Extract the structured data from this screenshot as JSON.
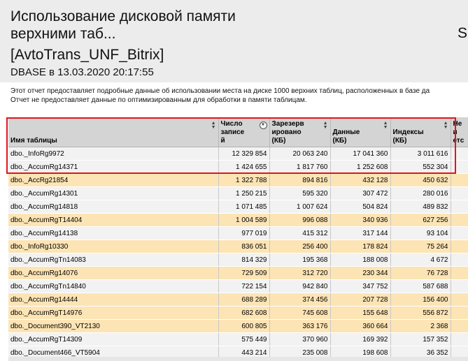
{
  "report": {
    "title_line1": "Использование дисковой памяти",
    "title_line2": "верхними таб...",
    "title_line3": "[AvtoTrans_UNF_Bitrix]",
    "subtitle": "DBASE в 13.03.2020 20:17:55",
    "right_edge_text": "S(",
    "description_line1": "Этот отчет предоставляет подробные данные об использовании места на диске 1000 верхних таблиц, расположенных в базе да",
    "description_line2": "Отчет не предоставляет данные по оптимизированным для обработки в памяти таблицам."
  },
  "table": {
    "headers": {
      "name": "Имя таблицы",
      "records": "Число записей",
      "reserved": "Зарезервировано (КБ)",
      "data": "Данные (КБ)",
      "indexes": "Индексы (КБ)",
      "unused": "Не испол..."
    },
    "header_display": {
      "records": [
        "Число",
        "записе",
        "й"
      ],
      "reserved": [
        "Зарезерв",
        "ировано",
        "(КБ)"
      ],
      "data": [
        "Данные",
        "(КБ)"
      ],
      "indexes": [
        "Индексы",
        "(КБ)"
      ],
      "unused": [
        "Не",
        "и",
        "етс"
      ]
    },
    "rows": [
      {
        "name": "dbo._InfoRg9972",
        "records": "12 329 854",
        "reserved": "20 063 240",
        "data": "17 041 360",
        "indexes": "3 011 616",
        "shade": "w"
      },
      {
        "name": "dbo._AccumRg14371",
        "records": "1 424 655",
        "reserved": "1 817 760",
        "data": "1 252 608",
        "indexes": "552 304",
        "shade": "w"
      },
      {
        "name": "dbo._AccRg21854",
        "records": "1 322 788",
        "reserved": "894 816",
        "data": "432 128",
        "indexes": "450 632",
        "shade": "o"
      },
      {
        "name": "dbo._AccumRg14301",
        "records": "1 250 215",
        "reserved": "595 320",
        "data": "307 472",
        "indexes": "280 016",
        "shade": "w"
      },
      {
        "name": "dbo._AccumRg14818",
        "records": "1 071 485",
        "reserved": "1 007 624",
        "data": "504 824",
        "indexes": "489 832",
        "shade": "w"
      },
      {
        "name": "dbo._AccumRgT14404",
        "records": "1 004 589",
        "reserved": "996 088",
        "data": "340 936",
        "indexes": "627 256",
        "shade": "o"
      },
      {
        "name": "dbo._AccumRg14138",
        "records": "977 019",
        "reserved": "415 312",
        "data": "317 144",
        "indexes": "93 104",
        "shade": "w"
      },
      {
        "name": "dbo._InfoRg10330",
        "records": "836 051",
        "reserved": "256 400",
        "data": "178 824",
        "indexes": "75 264",
        "shade": "o"
      },
      {
        "name": "dbo._AccumRgTn14083",
        "records": "814 329",
        "reserved": "195 368",
        "data": "188 008",
        "indexes": "4 672",
        "shade": "w"
      },
      {
        "name": "dbo._AccumRg14076",
        "records": "729 509",
        "reserved": "312 720",
        "data": "230 344",
        "indexes": "76 728",
        "shade": "o"
      },
      {
        "name": "dbo._AccumRgTn14840",
        "records": "722 154",
        "reserved": "942 840",
        "data": "347 752",
        "indexes": "587 688",
        "shade": "w"
      },
      {
        "name": "dbo._AccumRg14444",
        "records": "688 289",
        "reserved": "374 456",
        "data": "207 728",
        "indexes": "156 400",
        "shade": "o"
      },
      {
        "name": "dbo._AccumRgT14976",
        "records": "682 608",
        "reserved": "745 608",
        "data": "155 648",
        "indexes": "556 872",
        "shade": "o"
      },
      {
        "name": "dbo._Document390_VT2130",
        "records": "600 805",
        "reserved": "363 176",
        "data": "360 664",
        "indexes": "2 368",
        "shade": "o"
      },
      {
        "name": "dbo._AccumRgT14309",
        "records": "575 449",
        "reserved": "370 960",
        "data": "169 392",
        "indexes": "157 352",
        "shade": "w"
      },
      {
        "name": "dbo._Document466_VT5904",
        "records": "443 214",
        "reserved": "235 008",
        "data": "198 608",
        "indexes": "36 352",
        "shade": "w"
      }
    ]
  },
  "colors": {
    "header_bg": "#ececec",
    "row_white": "#f2f2f2",
    "row_orange": "#fce4b5",
    "highlight_border": "#e2141b"
  },
  "icons": {
    "sort": "sort-arrows-icon",
    "filter": "filter-dropdown-icon"
  }
}
